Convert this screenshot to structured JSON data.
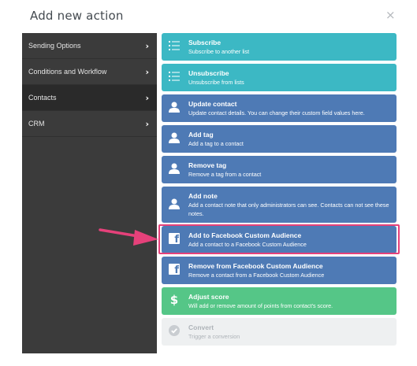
{
  "dialog": {
    "title": "Add new action",
    "close_symbol": "×"
  },
  "sidebar": {
    "items": [
      {
        "label": "Sending Options",
        "chevron": "›",
        "active": false
      },
      {
        "label": "Conditions and Workflow",
        "chevron": "›",
        "active": false
      },
      {
        "label": "Contacts",
        "chevron": "›",
        "active": true
      },
      {
        "label": "CRM",
        "chevron": "›",
        "active": false
      }
    ]
  },
  "actions": [
    {
      "title": "Subscribe",
      "description": "Subscribe to another list",
      "icon": "list-icon",
      "color": "#3cb8c4"
    },
    {
      "title": "Unsubscribe",
      "description": "Unsubscribe from lists",
      "icon": "list-icon",
      "color": "#3cb8c4"
    },
    {
      "title": "Update contact",
      "description": "Update contact details. You can change their custom field values here.",
      "icon": "person-icon",
      "color": "#4e7ab5"
    },
    {
      "title": "Add tag",
      "description": "Add a tag to a contact",
      "icon": "person-icon",
      "color": "#4e7ab5"
    },
    {
      "title": "Remove tag",
      "description": "Remove a tag from a contact",
      "icon": "person-icon",
      "color": "#4e7ab5"
    },
    {
      "title": "Add note",
      "description": "Add a contact note that only administrators can see. Contacts can not see these notes.",
      "icon": "person-icon",
      "color": "#4e7ab5"
    },
    {
      "title": "Add to Facebook Custom Audience",
      "description": "Add a contact to a Facebook Custom Audience",
      "icon": "facebook-icon",
      "color": "#4e7ab5",
      "highlighted": true
    },
    {
      "title": "Remove from Facebook Custom Audience",
      "description": "Remove a contact from a Facebook Custom Audience",
      "icon": "facebook-icon",
      "color": "#4e7ab5"
    },
    {
      "title": "Adjust score",
      "description": "Will add or remove amount of points from contact's score.",
      "icon": "dollar-icon",
      "color": "#55c687"
    },
    {
      "title": "Convert",
      "description": "Trigger a conversion",
      "icon": "check-circle-icon",
      "color": "#eef0f1",
      "disabled": true
    }
  ],
  "colors": {
    "highlight": "#e5417a",
    "arrow": "#e5417a",
    "sidebar_bg": "#3b3b3b"
  }
}
